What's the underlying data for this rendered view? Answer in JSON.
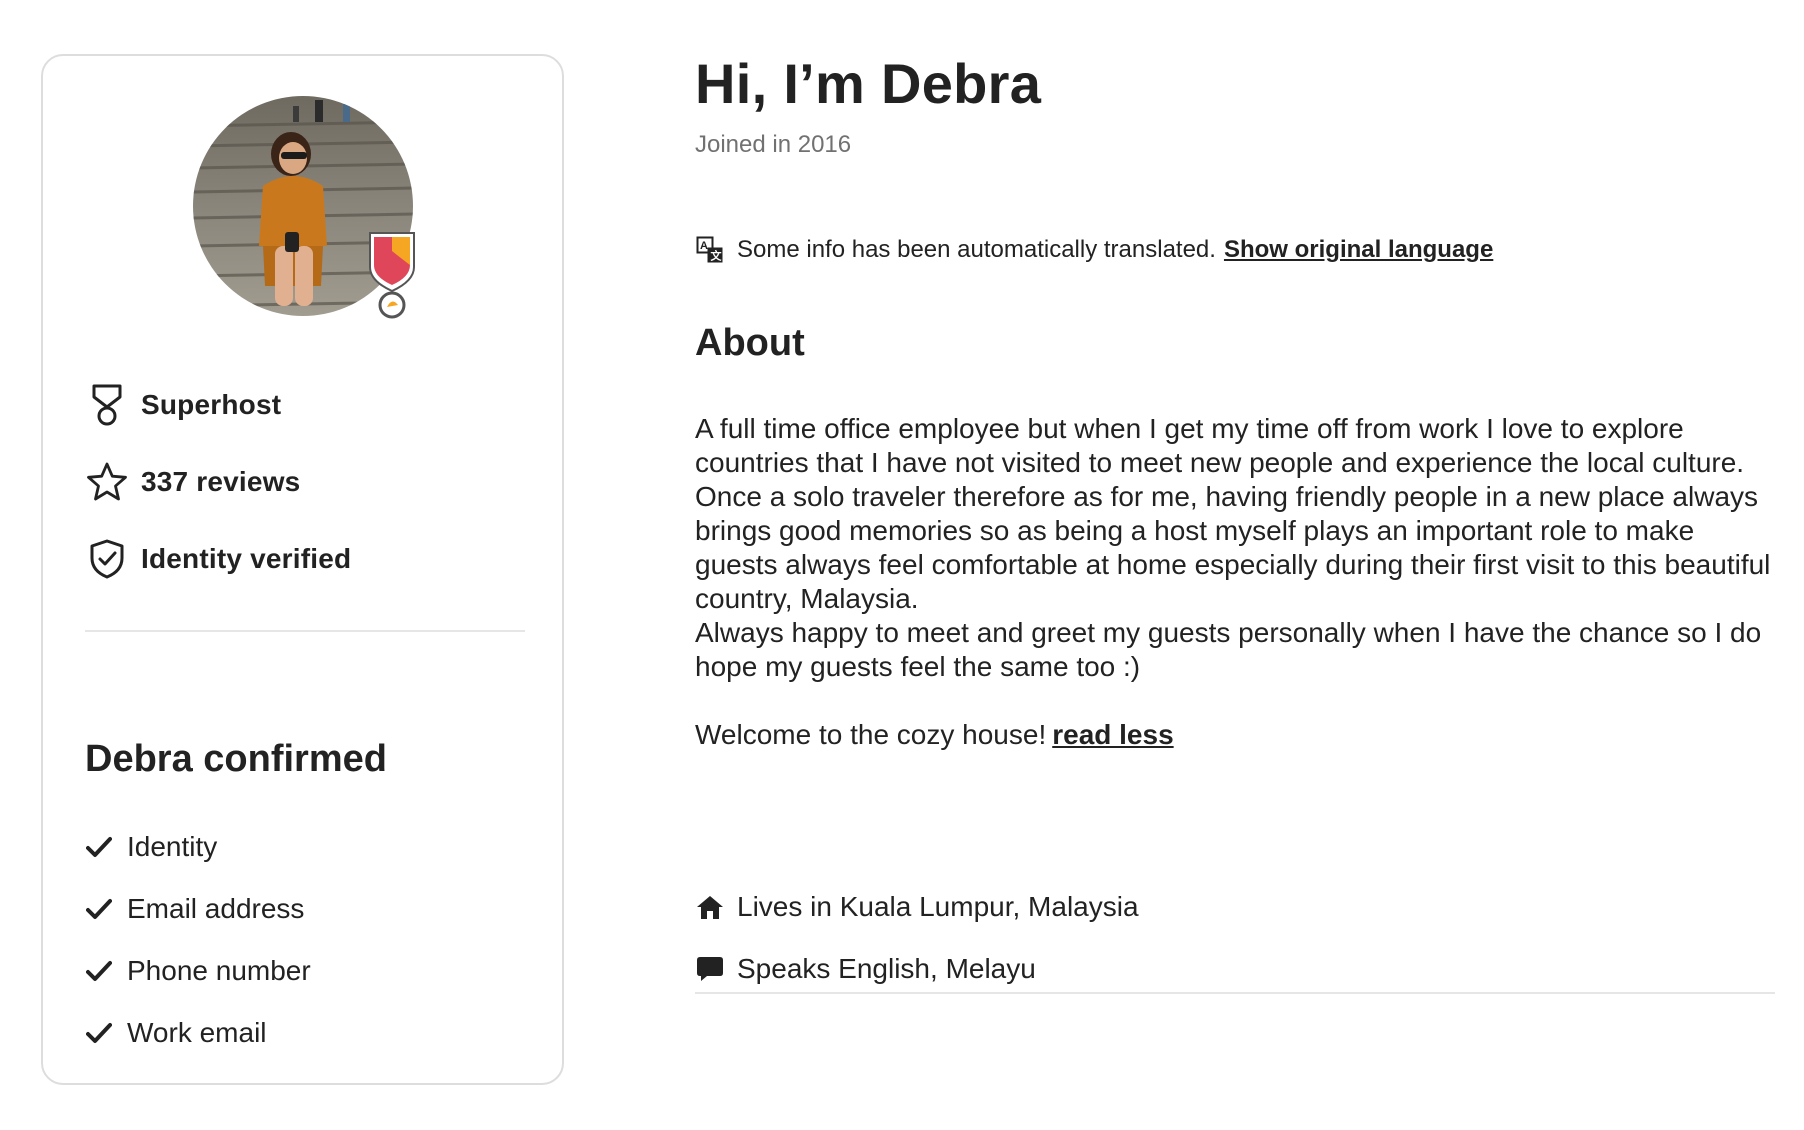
{
  "profile": {
    "greeting": "Hi, I’m Debra",
    "joined": "Joined in 2016",
    "avatar_alt": "Debra profile photo"
  },
  "stats": [
    {
      "icon": "superhost-icon",
      "label": "Superhost"
    },
    {
      "icon": "star-icon",
      "label": "337 reviews"
    },
    {
      "icon": "shield-check-icon",
      "label": "Identity verified"
    }
  ],
  "confirmed": {
    "title": "Debra confirmed",
    "items": [
      "Identity",
      "Email address",
      "Phone number",
      "Work email"
    ]
  },
  "translation": {
    "note": "Some info has been automatically translated.",
    "link": "Show original language"
  },
  "about": {
    "title": "About",
    "paragraphs": [
      "A full time office employee but when I get my time off from work I love to explore countries that I have not visited to meet new people and experience the local culture.",
      "Once a solo traveler therefore as for me, having friendly people in a new place always brings good memories so as being a host myself plays an important role to make guests always feel comfortable at home especially during their first visit to this beautiful country, Malaysia.",
      "Always happy to meet and greet my guests personally when I have the chance so I do hope my guests feel the same too :)"
    ],
    "closing": "Welcome to the cozy house!",
    "read_less": "read less"
  },
  "facts": [
    {
      "icon": "home-icon",
      "label": "Lives in Kuala Lumpur, Malaysia"
    },
    {
      "icon": "speech-bubble-icon",
      "label": "Speaks English, Melayu"
    }
  ],
  "colors": {
    "text": "#222222",
    "muted": "#717171",
    "border": "#dddddd",
    "badge_red": "#e0465a",
    "badge_orange": "#f5a623"
  }
}
